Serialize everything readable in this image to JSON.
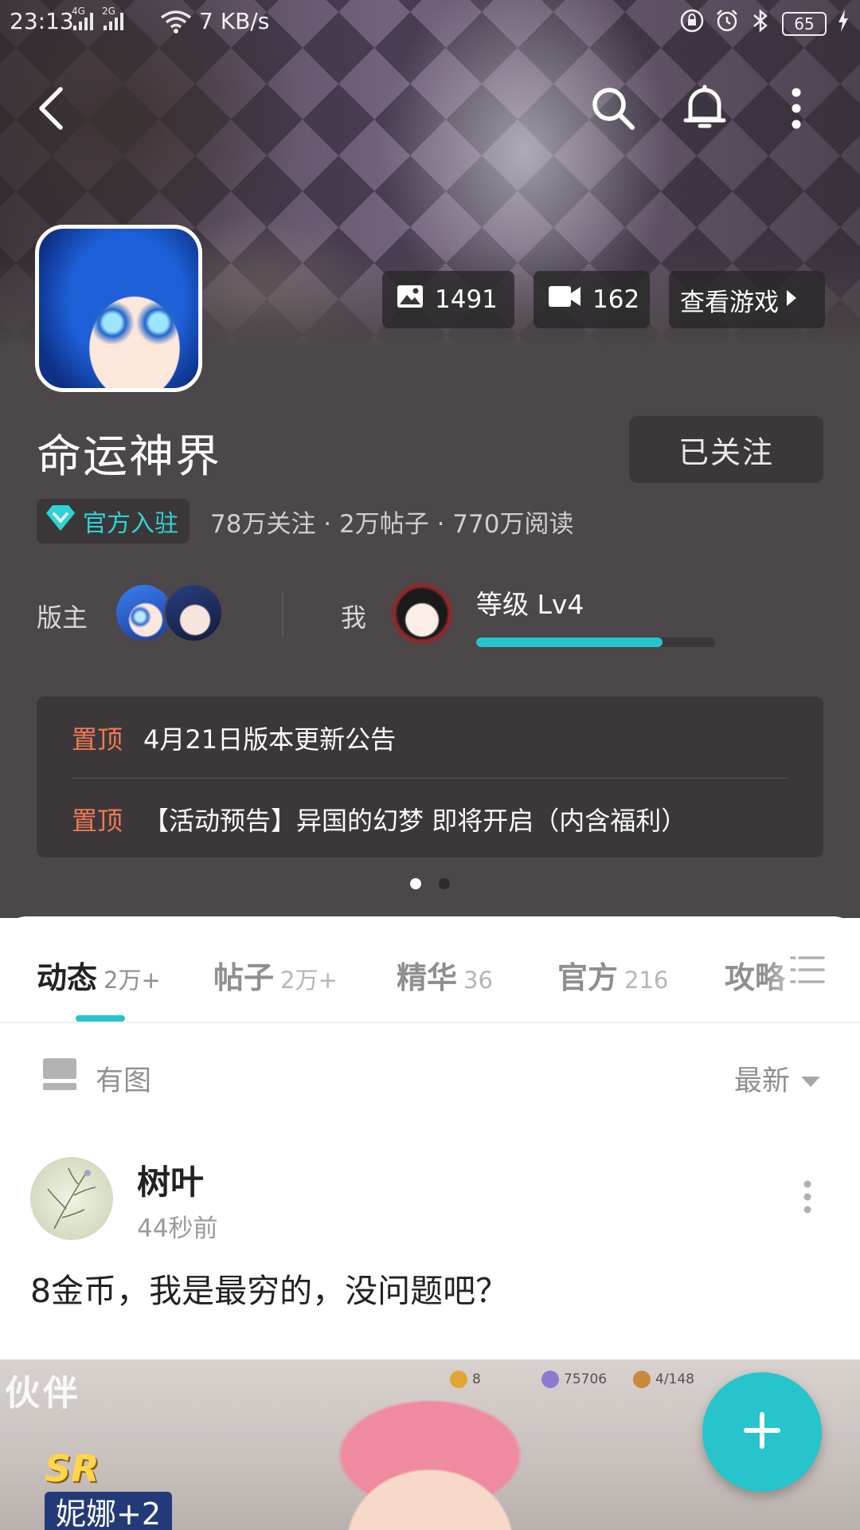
{
  "status_bar": {
    "time": "23:13",
    "net_labels": [
      "4G",
      "2G"
    ],
    "speed": "7 KB/s",
    "battery": "65"
  },
  "hero": {
    "stats": {
      "images": "1491",
      "videos": "162",
      "view_game": "查看游戏"
    }
  },
  "forum": {
    "title": "命运神界",
    "follow_button": "已关注",
    "official_badge": "官方入驻",
    "stats_line": "78万关注 · 2万帖子 · 770万阅读",
    "moderators_label": "版主",
    "me_label": "我",
    "level_text": "等级 Lv4",
    "level_progress_percent": 78
  },
  "pinned": [
    {
      "tag": "置顶",
      "title": "4月21日版本更新公告"
    },
    {
      "tag": "置顶",
      "title": "【活动预告】异国的幻梦 即将开启（内含福利）"
    }
  ],
  "carousel": {
    "pages": 2,
    "active": 1
  },
  "tabs": [
    {
      "label": "动态",
      "count": "2万+",
      "active": true
    },
    {
      "label": "帖子",
      "count": "2万+",
      "active": false
    },
    {
      "label": "精华",
      "count": "36",
      "active": false
    },
    {
      "label": "官方",
      "count": "216",
      "active": false
    },
    {
      "label": "攻略",
      "count": "",
      "active": false
    }
  ],
  "filter": {
    "has_image_label": "有图",
    "sort_label": "最新"
  },
  "post": {
    "author": "树叶",
    "time": "44秒前",
    "text": "8金币，我是最穷的，没问题吧？",
    "image": {
      "title": "伙伴",
      "rarity": "SR",
      "character": "妮娜+2",
      "resources": [
        "8",
        "75706",
        "4/148"
      ]
    }
  },
  "colors": {
    "accent": "#27c4cc",
    "pinned_tag": "#f07a53",
    "dark_bg": "#4c4748"
  },
  "icons": {
    "back": "back-arrow-icon",
    "search": "search-icon",
    "notifications": "bell-icon",
    "more": "more-vertical-icon",
    "images": "image-icon",
    "videos": "video-camera-icon",
    "compose": "plus-icon"
  }
}
